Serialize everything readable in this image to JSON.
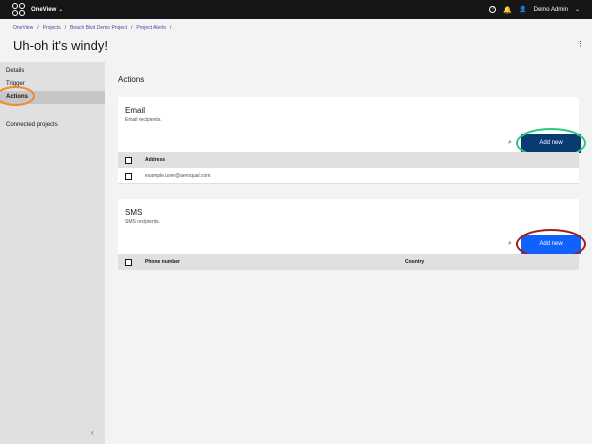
{
  "topbar": {
    "app_name": "OneView",
    "app_chevron": "⌄",
    "help_glyph": "?",
    "bell_glyph": "🔔",
    "user_glyph": "👤",
    "user_name": "Demo Admin",
    "user_chevron": "⌄"
  },
  "breadcrumb": {
    "items": [
      "OneView",
      "Projects",
      "Beach Blvd Demo Project",
      "Project Alerts"
    ],
    "separator": "/"
  },
  "page": {
    "title": "Uh-oh it's windy!",
    "kebab_glyph": "⋮"
  },
  "sidebar": {
    "items": [
      "Details",
      "Trigger",
      "Actions"
    ],
    "connected": "Connected projects",
    "collapse_glyph": "‹"
  },
  "main": {
    "heading": "Actions",
    "email": {
      "title": "Email",
      "subtitle": "Email recipients.",
      "search_glyph": "⌕",
      "add_label": "Add new",
      "col_address": "Address",
      "rows": [
        "example.user@aeroqual.com"
      ]
    },
    "sms": {
      "title": "SMS",
      "subtitle": "SMS recipients.",
      "search_glyph": "⌕",
      "add_label": "Add new",
      "col_phone": "Phone number",
      "col_country": "Country"
    }
  },
  "colors": {
    "topbar_bg": "#161616",
    "button_dark": "#0a3a72",
    "button_blue": "#0f62fe",
    "annotation_orange": "#f28c28",
    "annotation_green": "#2dc884",
    "annotation_red": "#a11e1e"
  }
}
